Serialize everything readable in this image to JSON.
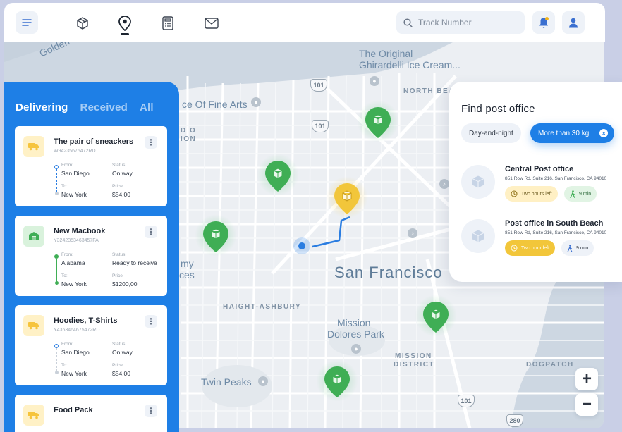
{
  "topbar": {
    "search_placeholder": "Track Number",
    "nav": [
      "menu",
      "package",
      "location",
      "calculator",
      "mail"
    ],
    "active_nav": "location"
  },
  "map": {
    "labels": {
      "golden_gate": "Golden G",
      "the_original": "The Original",
      "ghirardelli": "Ghirardelli Ice Cream...",
      "north_beach": "NORTH BEAC",
      "fine_arts": "ce Of Fine Arts",
      "hway_a": "D O",
      "hway_b": "ION",
      "my": "my",
      "ces": "ces",
      "san_francisco": "San Francisco",
      "haight": "HAIGHT-ASHBURY",
      "mission_dolores_1": "Mission",
      "mission_dolores_2": "Dolores Park",
      "mission_district_1": "MISSION",
      "mission_district_2": "DISTRICT",
      "twin_peaks": "Twin Peaks",
      "dogpatch": "DOGPATCH"
    },
    "routes": [
      "101",
      "101",
      "101",
      "280"
    ],
    "zoom_in": "+",
    "zoom_out": "−"
  },
  "left_panel": {
    "tabs": [
      "Delivering",
      "Received",
      "All"
    ],
    "active_tab": "Delivering",
    "cards": [
      {
        "title": "The pair of sneackers",
        "code": "W94235675472RD",
        "from_label": "From:",
        "from": "San Diego",
        "to_label": "To:",
        "to": "New York",
        "status_label": "Status:",
        "status": "On way",
        "price_label": "Price:",
        "price": "$54,00",
        "icon": "truck-icon",
        "icon_color": "yellow"
      },
      {
        "title": "New Macbook",
        "code": "Y3242353463457FA",
        "from_label": "From:",
        "from": "Alabama",
        "to_label": "To:",
        "to": "New York",
        "status_label": "Status:",
        "status": "Ready to receive",
        "price_label": "Price:",
        "price": "$1200,00",
        "icon": "warehouse-icon",
        "icon_color": "green"
      },
      {
        "title": "Hoodies, T-Shirts",
        "code": "Y4363464675472RD",
        "from_label": "From:",
        "from": "San Diego",
        "to_label": "To:",
        "to": "New York",
        "status_label": "Status:",
        "status": "On way",
        "price_label": "Price:",
        "price": "$54,00",
        "icon": "truck-icon",
        "icon_color": "yellow"
      },
      {
        "title": "Food Pack",
        "icon": "truck-icon",
        "icon_color": "yellow"
      }
    ],
    "more_glyph": "⋮"
  },
  "right_panel": {
    "title": "Find post office",
    "chips": [
      "Day-and-night",
      "More than 30 kg"
    ],
    "chip_close": "×",
    "offices": [
      {
        "name": "Central Post office",
        "address": "851 Row Rd, Suite 216, San Francisco, CA 94010",
        "time": "Two hours left",
        "walk": "9 min"
      },
      {
        "name": "Post office in South Beach",
        "address": "851 Row Rd, Suite 216, San Francisco, CA 94010",
        "time": "Two hour left",
        "walk": "9 min"
      }
    ]
  },
  "colors": {
    "accent": "#1e7fe6",
    "pin_green": "#3fae55",
    "pin_yellow": "#f2c63a",
    "map_bg": "#eceff3"
  }
}
